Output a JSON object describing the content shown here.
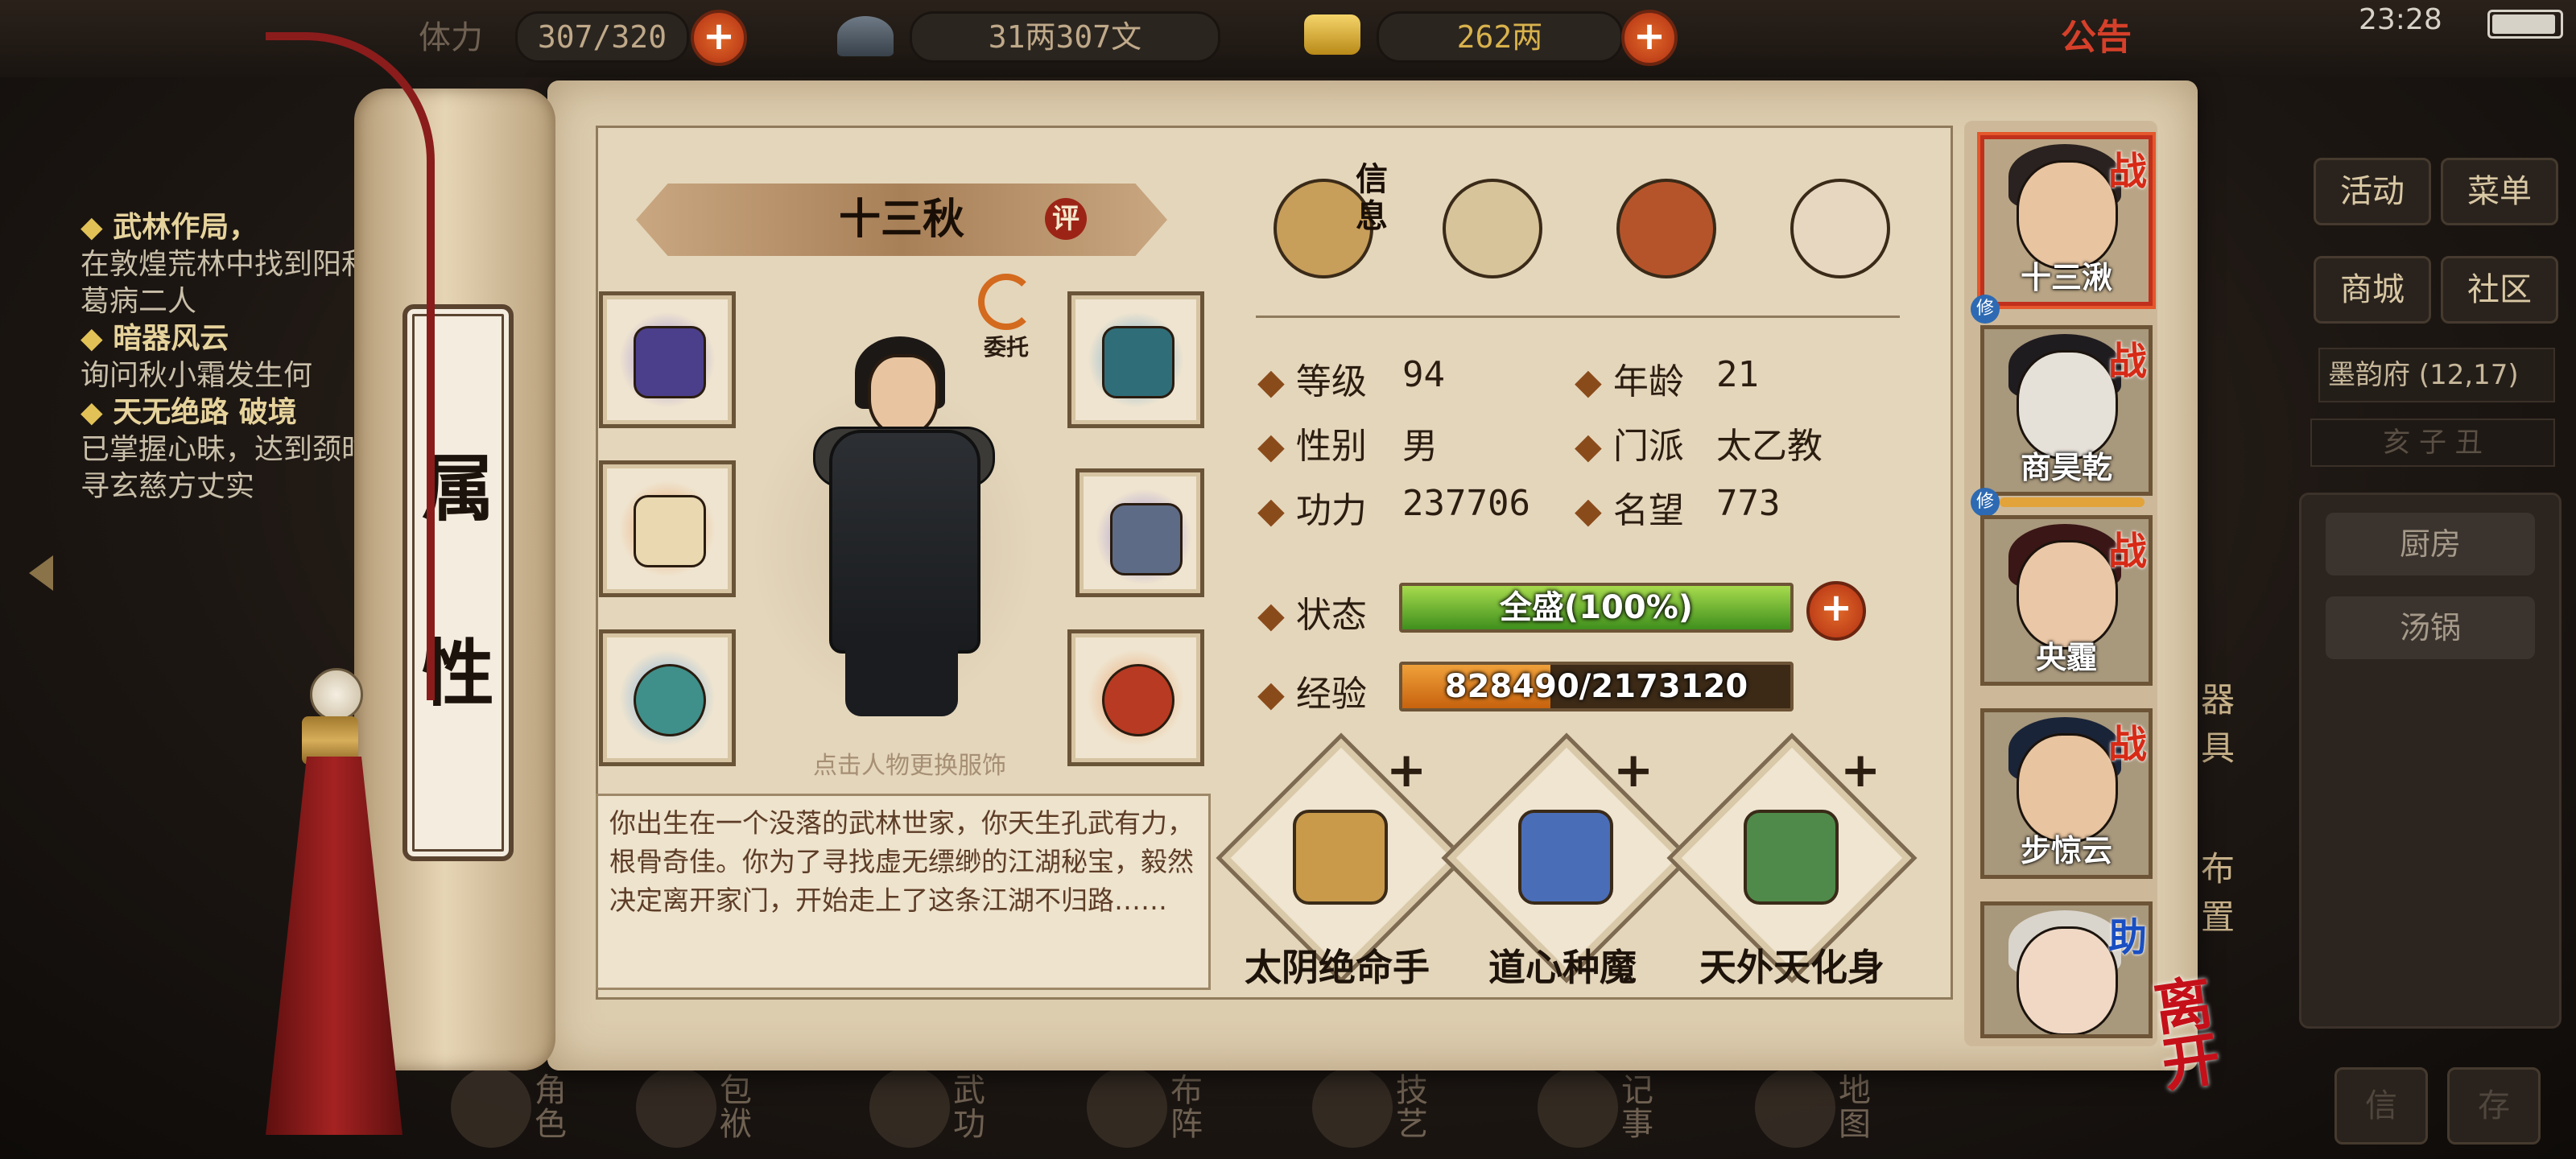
{
  "top_bar": {
    "stamina_label": "体力",
    "stamina_value": "307/320",
    "silver_value": "31两307文",
    "gold_value": "262两",
    "announcement": "公告",
    "clock": "23:28"
  },
  "quests": [
    {
      "title": "武林作局，",
      "desc": "在敦煌荒林中找到阳和葛病二人"
    },
    {
      "title": "暗器风云",
      "desc": "询问秋小霜发生何"
    },
    {
      "title": "天无绝路 破境",
      "desc": "已掌握心昧，达到颈时寻玄慈方丈实"
    }
  ],
  "scroll_title": [
    "属",
    "性"
  ],
  "character": {
    "name": "十三秋",
    "rate_badge": "评",
    "delegate_label": "委托",
    "outfit_hint": "点击人物更换服饰",
    "bio": "你出生在一个没落的武林世家，你天生孔武有力，根骨奇佳。你为了寻找虚无缥缈的江湖秘宝，毅然决定离开家门，开始走上了这条江湖不归路……"
  },
  "tabs": {
    "info_label": "信息",
    "items": [
      "info-tab",
      "scroll-tab",
      "bagua-tab",
      "meridian-tab"
    ]
  },
  "stats": {
    "level_label": "等级",
    "level": "94",
    "age_label": "年龄",
    "age": "21",
    "gender_label": "性别",
    "gender": "男",
    "sect_label": "门派",
    "sect": "太乙教",
    "power_label": "功力",
    "power": "237706",
    "fame_label": "名望",
    "fame": "773",
    "state_label": "状态",
    "state": "全盛(100%)",
    "state_pct": 100,
    "exp_label": "经验",
    "exp": "828490/2173120",
    "exp_fraction": 0.381
  },
  "skills": [
    {
      "name": "太阴绝命手",
      "color": "#c89a4a"
    },
    {
      "name": "道心种魔",
      "color": "#4a6db8"
    },
    {
      "name": "天外天化身",
      "color": "#4f8a4a"
    }
  ],
  "party": [
    {
      "name": "十三湫",
      "badge": "战",
      "face": "#e8c4a0",
      "hair": "#2a2220",
      "bg": "#b9a585"
    },
    {
      "name": "商昊乾",
      "badge": "战",
      "face": "#e5e0d8",
      "hair": "#1f1c20",
      "bg": "#a8987c"
    },
    {
      "name": "央霾",
      "badge": "战",
      "face": "#eac7a6",
      "hair": "#3a1616",
      "bg": "#a8987c"
    },
    {
      "name": "步惊云",
      "badge": "战",
      "face": "#e8c4a0",
      "hair": "#1a2438",
      "bg": "#a8987c"
    },
    {
      "name": "",
      "badge": "助",
      "face": "#f0d8c4",
      "hair": "#d9d4cc",
      "bg": "#a8987c"
    }
  ],
  "party_xiu": "修",
  "leave": "离开",
  "side_menu": {
    "activity": "活动",
    "menu": "菜单",
    "shop": "商城",
    "community": "社区",
    "location": "墨韵府 (12,17)",
    "time": "亥 子 丑",
    "kitchen": "厨房",
    "pot": "汤锅",
    "vert1": "器具",
    "vert2": "布置"
  },
  "bottom_nav": [
    "角色",
    "包袱",
    "武功",
    "布阵",
    "技艺",
    "记事",
    "地图"
  ],
  "bottom_right": [
    "信",
    "存"
  ],
  "colors": {
    "accent_red": "#c0301c",
    "state_green": "#5fae2c",
    "exp_orange": "#e3862a"
  }
}
